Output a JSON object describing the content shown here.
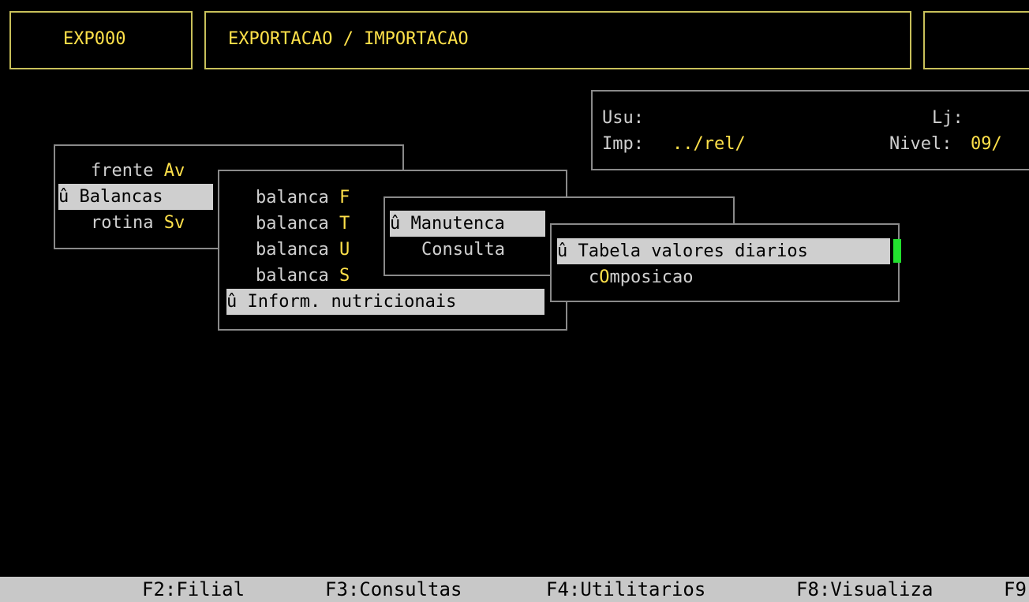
{
  "header": {
    "program_code": "EXP000",
    "program_title": "EXPORTACAO / IMPORTACAO"
  },
  "info": {
    "usu_label": "Usu:",
    "lj_label": "Lj:",
    "imp_label": "Imp:",
    "imp_value": "../rel/",
    "nivel_label": "Nivel:",
    "nivel_value": "09/"
  },
  "menu1": {
    "items": [
      {
        "text": "frente ",
        "hot": "Av"
      },
      {
        "marker": "û",
        "text": " Balancas"
      },
      {
        "text": "rotina ",
        "hot": "Sv"
      }
    ]
  },
  "menu2": {
    "items": [
      {
        "text": "balanca ",
        "hot": "F"
      },
      {
        "text": "balanca ",
        "hot": "T"
      },
      {
        "text": "balanca ",
        "hot": "U"
      },
      {
        "text": "balanca ",
        "hot": "S"
      },
      {
        "marker": "û",
        "text": " Inform. nutricionais"
      }
    ]
  },
  "menu3": {
    "items": [
      {
        "marker": "û",
        "text": " Manutenca"
      },
      {
        "text": "Consulta"
      }
    ]
  },
  "menu4": {
    "items": [
      {
        "marker": "û",
        "text": " Tabela valores diarios"
      },
      {
        "pre": "c",
        "hot": "O",
        "post": "mposicao"
      }
    ]
  },
  "function_keys": [
    "F2:Filial",
    "F3:Consultas",
    "F4:Utilitarios",
    "F8:Visualiza",
    "F9"
  ],
  "colors": {
    "background": "#000000",
    "menu_text": "#d0d0d0",
    "hotkey": "#ffe14a",
    "highlight_bg": "#cfcfcf",
    "cursor": "#22e02e",
    "status_bar": "#c8c8c8"
  }
}
